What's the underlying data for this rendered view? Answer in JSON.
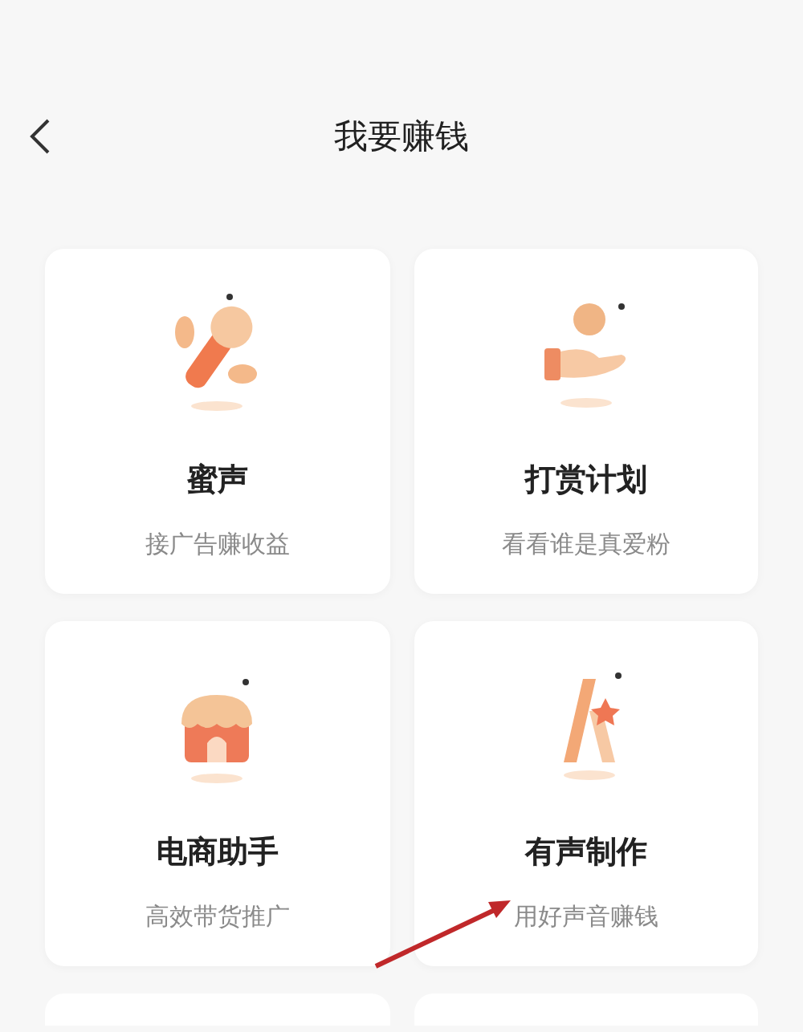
{
  "header": {
    "title": "我要赚钱"
  },
  "cards": [
    {
      "kind": "microphone",
      "title": "蜜声",
      "subtitle": "接广告赚收益"
    },
    {
      "kind": "hand-coin",
      "title": "打赏计划",
      "subtitle": "看看谁是真爱粉"
    },
    {
      "kind": "shop",
      "title": "电商助手",
      "subtitle": "高效带货推广"
    },
    {
      "kind": "star-a",
      "title": "有声制作",
      "subtitle": "用好声音赚钱"
    }
  ],
  "annotation": {
    "kind": "arrow"
  }
}
